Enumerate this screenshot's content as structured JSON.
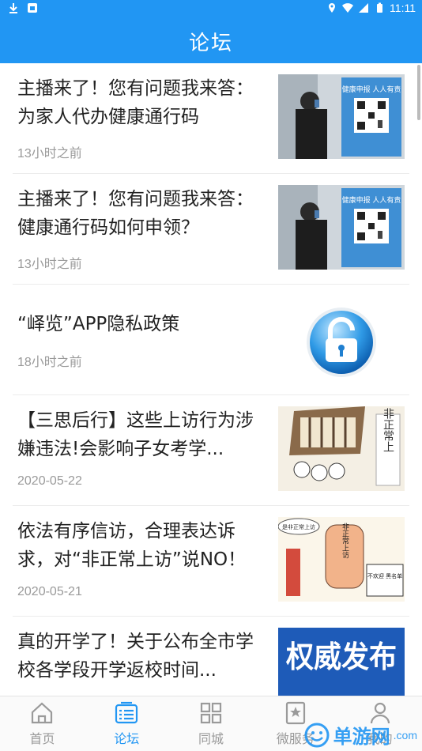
{
  "status_bar": {
    "time": "11:11"
  },
  "header": {
    "title": "论坛"
  },
  "articles": [
    {
      "title": "主播来了！您有问题我来答：为家人代办健康通行码",
      "time": "13小时之前",
      "thumb": "qr-poster-photo",
      "poster_text": "健康申报 人人有责"
    },
    {
      "title": "主播来了！您有问题我来答：健康通行码如何申领？",
      "time": "13小时之前",
      "thumb": "qr-poster-photo",
      "poster_text": "健康申报 人人有责"
    },
    {
      "title": "“峄览”APP隐私政策",
      "time": "18小时之前",
      "thumb": "lock-icon"
    },
    {
      "title": "【三思后行】这些上访行为涉嫌违法!会影响子女考学...",
      "time": "2020-05-22",
      "thumb": "cartoon-illustration",
      "sign_text": "非正常上"
    },
    {
      "title": "依法有序信访，合理表达诉求，对“非正常上访”说NO！",
      "time": "2020-05-21",
      "thumb": "cartoon-hand-illustration",
      "bubble_text": "是非正常上访",
      "hand_text": "非正常上访",
      "board_text": "不欢迎 黑名单"
    },
    {
      "title": "真的开学了！关于公布全市学校各学段开学返校时间...",
      "time": "",
      "thumb": "authority-banner",
      "banner_text": "权威发布"
    }
  ],
  "tabs": [
    {
      "label": "首页",
      "icon": "home-icon",
      "active": false
    },
    {
      "label": "论坛",
      "icon": "forum-list-icon",
      "active": true
    },
    {
      "label": "同城",
      "icon": "grid-icon",
      "active": false
    },
    {
      "label": "微服务",
      "icon": "star-card-icon",
      "active": false
    },
    {
      "label": "我的",
      "icon": "person-icon",
      "active": false
    }
  ],
  "watermark": {
    "text": "单游网",
    "suffix": ".com"
  },
  "colors": {
    "primary": "#2196f3",
    "text": "#222222",
    "muted": "#9a9a9a"
  }
}
